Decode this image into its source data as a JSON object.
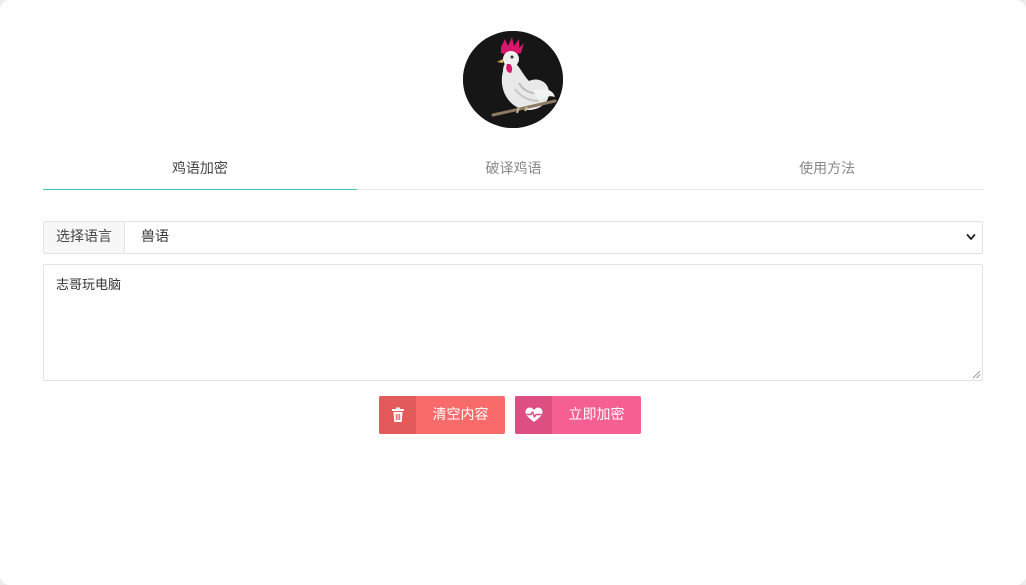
{
  "avatar": {
    "icon": "rooster-icon"
  },
  "tabs": [
    {
      "label": "鸡语加密",
      "active": true
    },
    {
      "label": "破译鸡语",
      "active": false
    },
    {
      "label": "使用方法",
      "active": false
    }
  ],
  "language": {
    "label": "选择语言",
    "selected": "兽语",
    "icon": "chevron-down-icon"
  },
  "input": {
    "value": "志哥玩电脑"
  },
  "buttons": {
    "clear": {
      "label": "清空内容",
      "icon": "trash-icon",
      "color": "#f96b6b"
    },
    "encrypt": {
      "label": "立即加密",
      "icon": "heart-pulse-icon",
      "color": "#f55f92"
    }
  },
  "colors": {
    "tab_underline": "#3ec6bf"
  }
}
